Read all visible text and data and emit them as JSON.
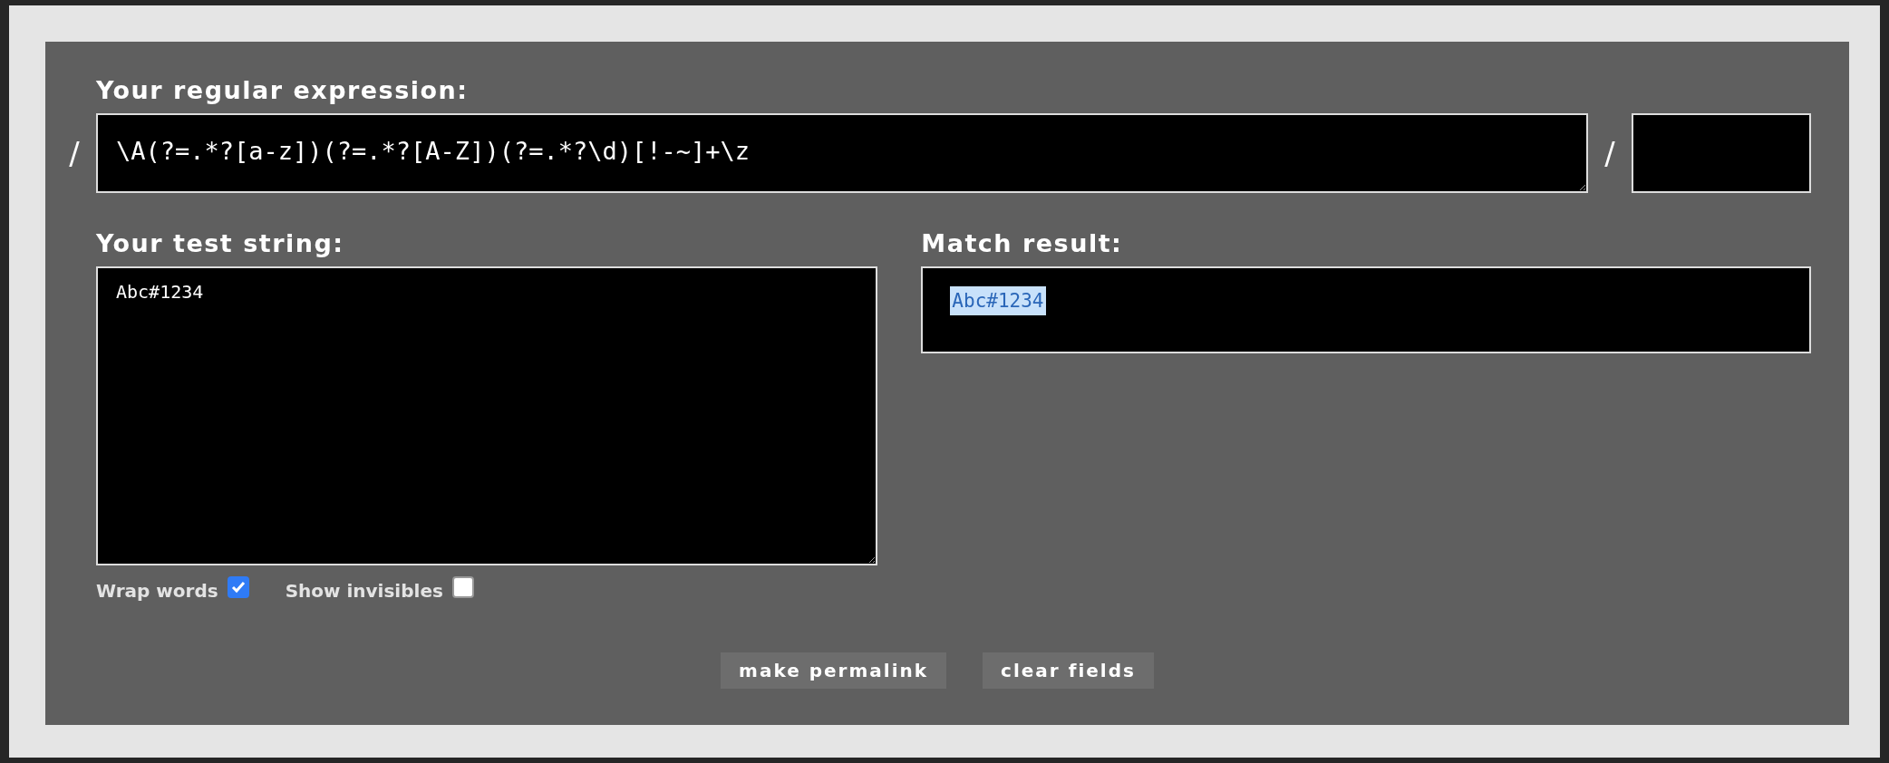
{
  "regex": {
    "label": "Your regular expression:",
    "open_delimiter": "/",
    "value": "\\A(?=.*?[a-z])(?=.*?[A-Z])(?=.*?\\d)[!-~]+\\z",
    "close_delimiter": "/"
  },
  "test_string": {
    "label": "Your test string:",
    "value": "Abc#1234"
  },
  "match_result": {
    "label": "Match result:",
    "text": "Abc#1234",
    "highlighted": true
  },
  "options": [
    {
      "label": "Wrap words",
      "checked": true
    },
    {
      "label": "Show invisibles",
      "checked": false
    }
  ],
  "buttons": [
    "make permalink",
    "clear fields"
  ]
}
